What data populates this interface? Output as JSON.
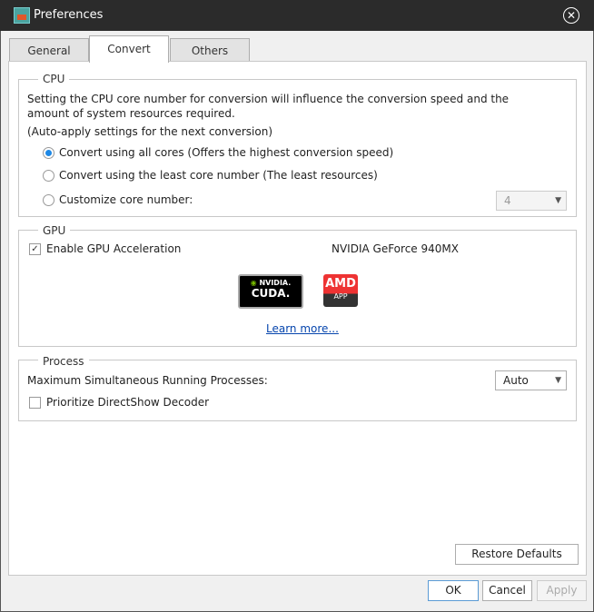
{
  "window": {
    "title": "Preferences"
  },
  "tabs": [
    {
      "label": "General"
    },
    {
      "label": "Convert"
    },
    {
      "label": "Others"
    }
  ],
  "cpu": {
    "title": "CPU",
    "description": "Setting the CPU core number for conversion will influence the conversion speed and the amount of system resources required.",
    "auto_note": "(Auto-apply settings for the next conversion)",
    "options": [
      {
        "label": "Convert using all cores (Offers the highest conversion speed)",
        "selected": true
      },
      {
        "label": "Convert using the least core number (The least resources)",
        "selected": false
      },
      {
        "label": "Customize core number:",
        "selected": false
      }
    ],
    "core_value": "4"
  },
  "gpu": {
    "title": "GPU",
    "enable_label": "Enable GPU Acceleration",
    "enabled": true,
    "device": "NVIDIA GeForce 940MX",
    "nvidia_logo": "NVIDIA CUDA",
    "amd_logo": "AMD APP",
    "learn_more": "Learn more..."
  },
  "process": {
    "title": "Process",
    "max_label": "Maximum Simultaneous Running Processes:",
    "max_value": "Auto",
    "directshow_label": "Prioritize DirectShow Decoder",
    "directshow_checked": false
  },
  "buttons": {
    "restore": "Restore Defaults",
    "ok": "OK",
    "cancel": "Cancel",
    "apply": "Apply"
  },
  "colors": {
    "accent": "#1e88e5",
    "titlebar": "#2b2b2b",
    "link": "#0645ad"
  }
}
